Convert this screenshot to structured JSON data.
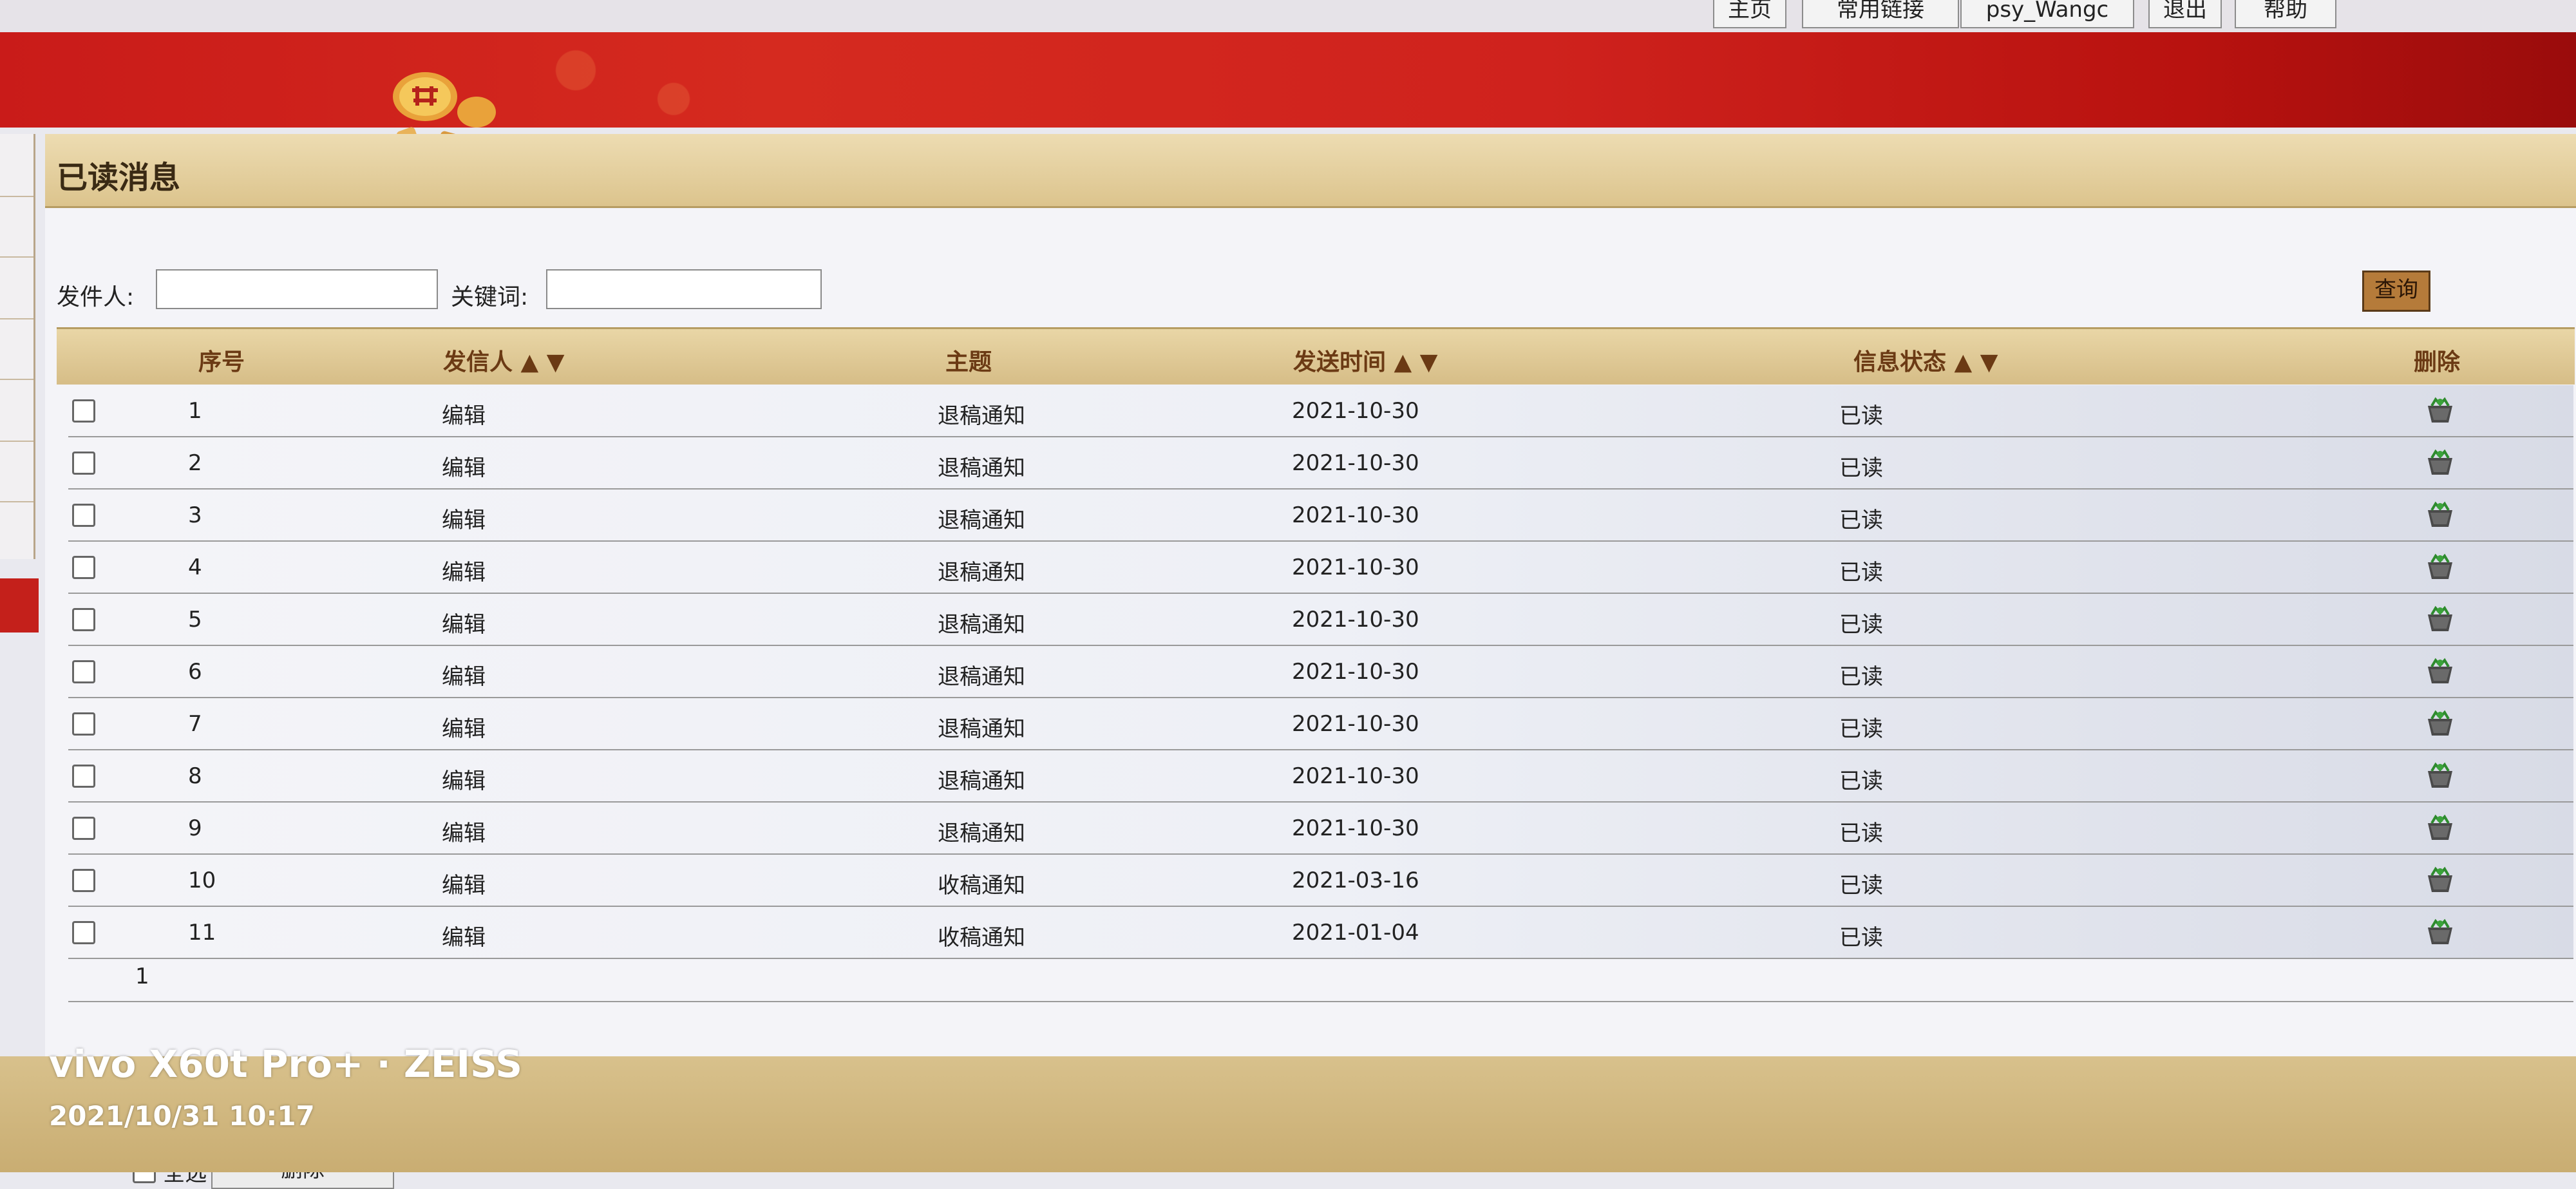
{
  "topbar": {
    "buttons": [
      "主页",
      "常用链接",
      "psy_Wangc",
      "退出",
      "帮助"
    ]
  },
  "page": {
    "title": "已读消息"
  },
  "search": {
    "sender_label": "发件人:",
    "keyword_label": "关键词:",
    "query_button": "查询"
  },
  "table": {
    "headers": {
      "index": "序号",
      "sender": "发信人 ▲ ▼",
      "subject": "主题",
      "time": "发送时间 ▲ ▼",
      "status": "信息状态 ▲ ▼",
      "delete": "删除"
    },
    "rows": [
      {
        "index": "1",
        "sender": "编辑",
        "subject": "退稿通知",
        "time": "2021-10-30",
        "status": "已读"
      },
      {
        "index": "2",
        "sender": "编辑",
        "subject": "退稿通知",
        "time": "2021-10-30",
        "status": "已读"
      },
      {
        "index": "3",
        "sender": "编辑",
        "subject": "退稿通知",
        "time": "2021-10-30",
        "status": "已读"
      },
      {
        "index": "4",
        "sender": "编辑",
        "subject": "退稿通知",
        "time": "2021-10-30",
        "status": "已读"
      },
      {
        "index": "5",
        "sender": "编辑",
        "subject": "退稿通知",
        "time": "2021-10-30",
        "status": "已读"
      },
      {
        "index": "6",
        "sender": "编辑",
        "subject": "退稿通知",
        "time": "2021-10-30",
        "status": "已读"
      },
      {
        "index": "7",
        "sender": "编辑",
        "subject": "退稿通知",
        "time": "2021-10-30",
        "status": "已读"
      },
      {
        "index": "8",
        "sender": "编辑",
        "subject": "退稿通知",
        "time": "2021-10-30",
        "status": "已读"
      },
      {
        "index": "9",
        "sender": "编辑",
        "subject": "退稿通知",
        "time": "2021-10-30",
        "status": "已读"
      },
      {
        "index": "10",
        "sender": "编辑",
        "subject": "收稿通知",
        "time": "2021-03-16",
        "status": "已读"
      },
      {
        "index": "11",
        "sender": "编辑",
        "subject": "收稿通知",
        "time": "2021-01-04",
        "status": "已读"
      }
    ]
  },
  "pager": {
    "page": "1"
  },
  "footer": {
    "select_all": "全选",
    "delete_button": "删除"
  },
  "watermark": {
    "device": "vivo X60t Pro+ · ZEISS",
    "datetime": "2021/10/31 10:17"
  }
}
